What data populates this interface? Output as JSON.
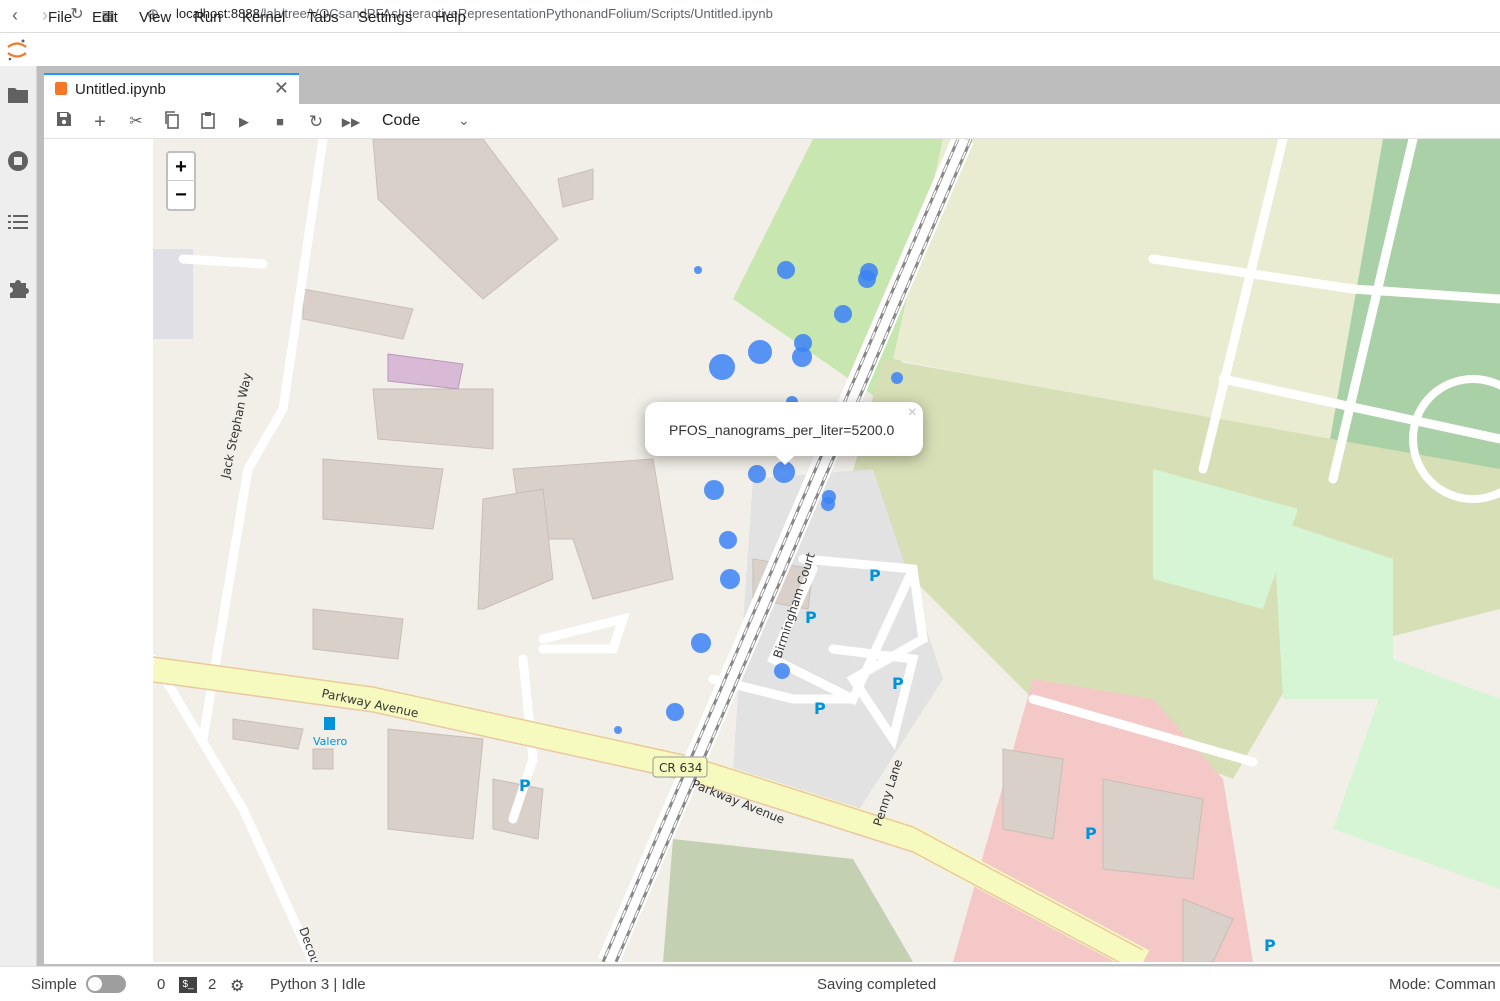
{
  "browser": {
    "url_host": "localhost:8888",
    "url_path": "/lab/tree/VOCsandPFAsInteractiveRepresentationPythonandFolium/Scripts/Untitled.ipynb"
  },
  "menu": [
    "File",
    "Edit",
    "View",
    "Run",
    "Kernel",
    "Tabs",
    "Settings",
    "Help"
  ],
  "tab": {
    "title": "Untitled.ipynb",
    "close": "✕"
  },
  "toolbar": {
    "cell_type": "Code"
  },
  "map": {
    "zoom_in": "+",
    "zoom_out": "−",
    "popup_text": "PFOS_nanograms_per_liter=5200.0",
    "popup_close": "×",
    "labels": {
      "jack": "Jack Stephan Way",
      "parkway1": "Parkway Avenue",
      "parkway2": "Parkway Avenue",
      "cr634": "CR 634",
      "birmingham": "Birmingham Court",
      "penny": "Penny Lane",
      "valero": "Valero",
      "decou": "Decou"
    },
    "marker_color": "#3b82f6"
  },
  "status": {
    "mode_label": "Simple",
    "count_a": "0",
    "count_b": "2",
    "kernel": "Python 3 | Idle",
    "message": "Saving completed",
    "mode": "Mode: Comman"
  }
}
